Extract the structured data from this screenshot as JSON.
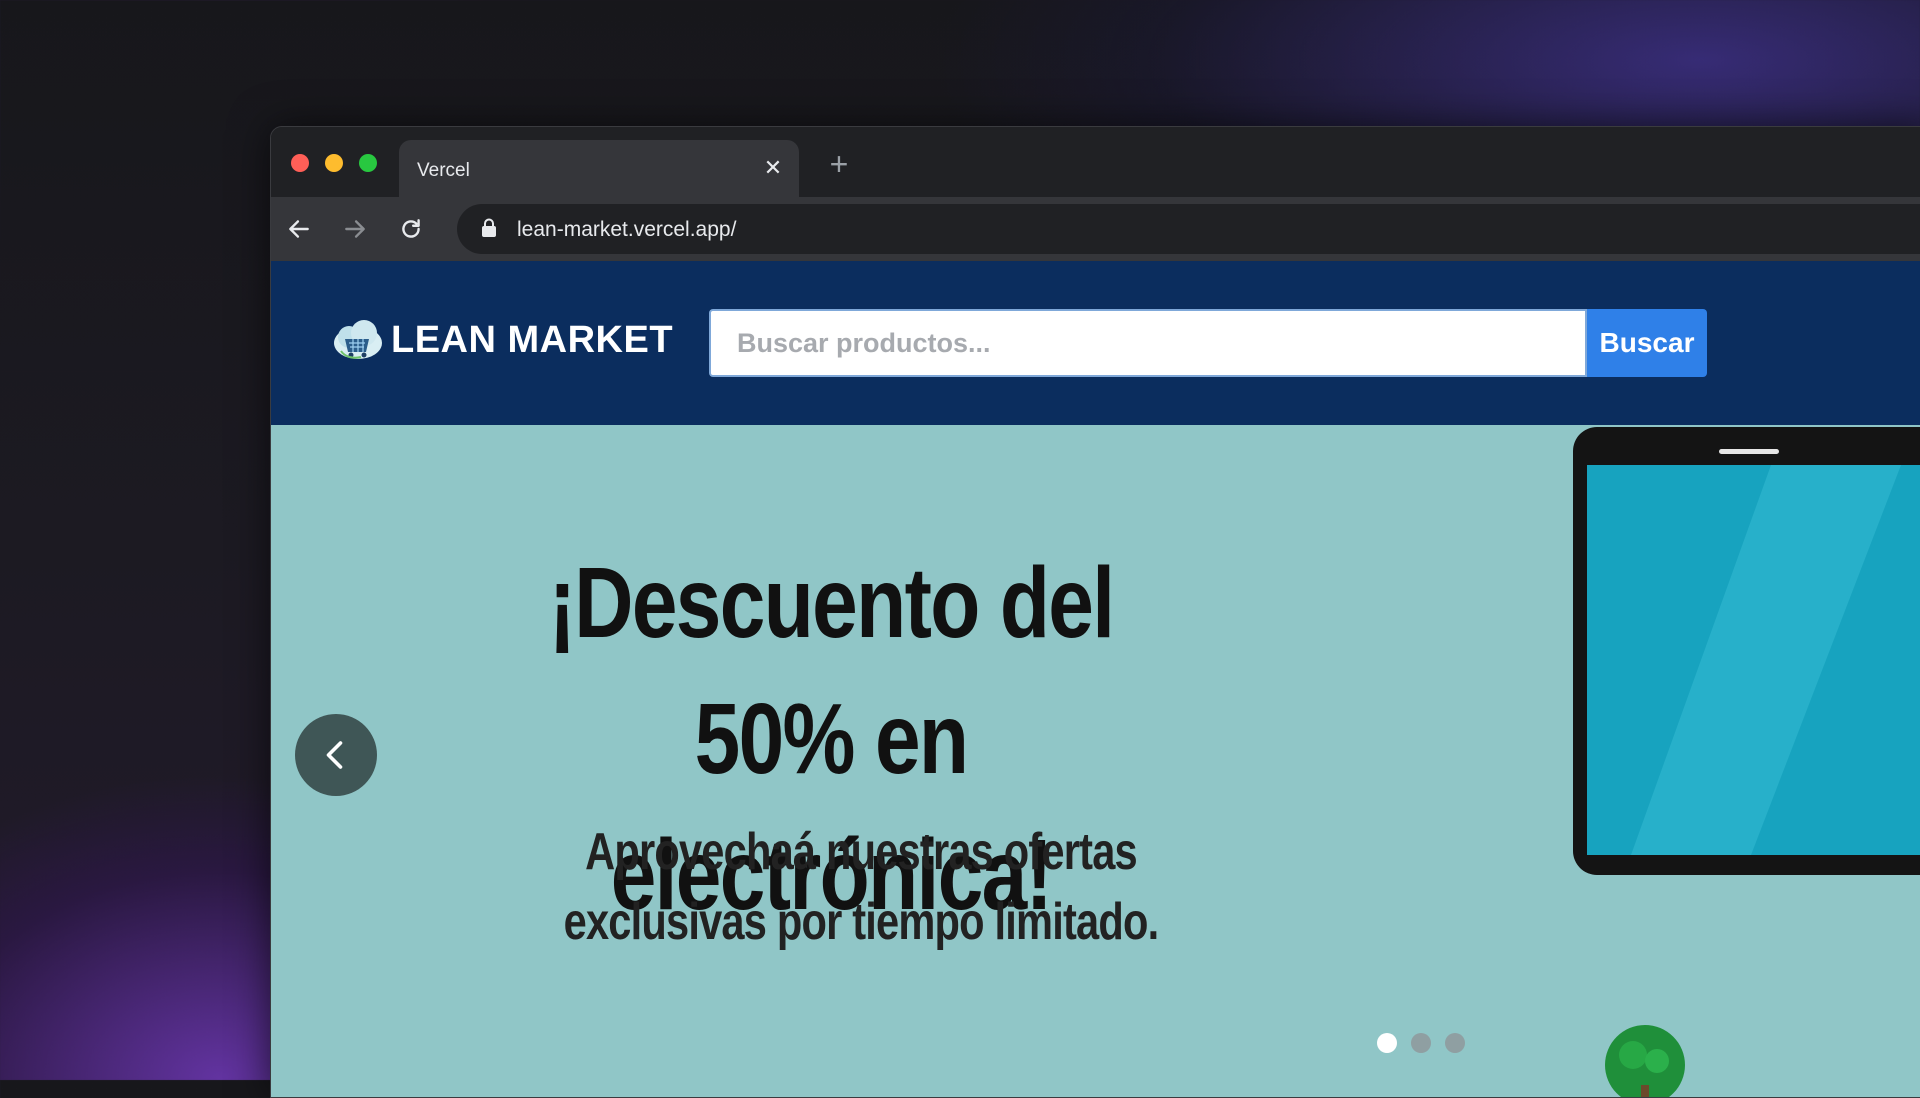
{
  "browser": {
    "tab_title": "Vercel",
    "url": "lean-market.vercel.app/"
  },
  "site": {
    "logo_text": "LEAN MARKET",
    "search_placeholder": "Buscar productos...",
    "search_button": "Buscar"
  },
  "banner": {
    "headline": "¡Descuento del 50% en electrónica!",
    "subtitle": "Aprovechaá nuestras ofertas exclusivas por tiempo limitado.",
    "slides_total": 3,
    "active_slide": 1
  },
  "colors": {
    "header_bg": "#0b2d5e",
    "search_button_bg": "#2f80e8",
    "banner_bg": "#90c6c7"
  },
  "icons": [
    "close-icon",
    "plus-icon",
    "back-arrow-icon",
    "forward-arrow-icon",
    "reload-icon",
    "lock-icon",
    "logo-icon",
    "chevron-left-icon"
  ]
}
